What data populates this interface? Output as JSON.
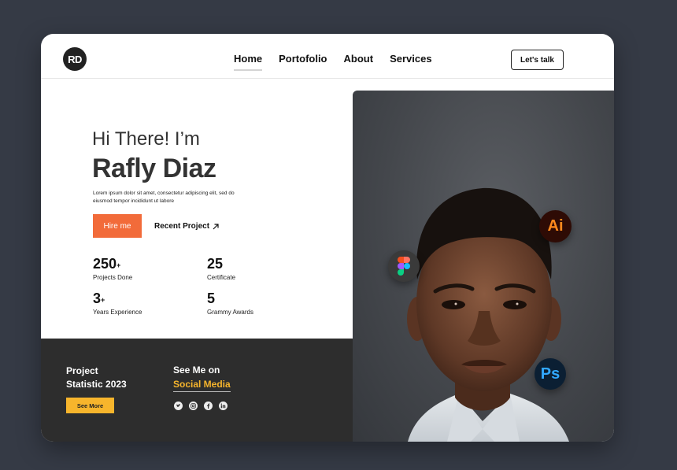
{
  "header": {
    "logo": "RD",
    "nav": [
      "Home",
      "Portofolio",
      "About",
      "Services"
    ],
    "cta": "Let's talk"
  },
  "hero": {
    "greeting": "Hi There! I’m",
    "name": "Rafly Diaz",
    "description": "Lorem ipsum dolor sit amet, consectetur adipiscing elit, sed do eiusmod tempor incididunt ut labore",
    "hire_label": "Hire me",
    "recent_label": "Recent Project"
  },
  "stats": [
    {
      "value": "250",
      "suffix": "+",
      "label": "Projects Done"
    },
    {
      "value": "25",
      "suffix": "",
      "label": "Certificate"
    },
    {
      "value": "3",
      "suffix": "+",
      "label": "Years Experience"
    },
    {
      "value": "5",
      "suffix": "",
      "label": "Grammy Awards"
    }
  ],
  "footer": {
    "project_line1": "Project",
    "project_line2": "Statistic 2023",
    "see_more": "See More",
    "see_me": "See Me on",
    "social_media": "Social Media",
    "social_icons": [
      "twitter-icon",
      "instagram-icon",
      "facebook-icon",
      "linkedin-icon"
    ]
  },
  "tools": {
    "illustrator": "Ai",
    "photoshop": "Ps",
    "figma": "figma-icon"
  },
  "colors": {
    "accent_orange": "#f26b3a",
    "accent_yellow": "#f7b52c",
    "dark_panel": "#2d2d2d",
    "page_bg": "#353a45"
  }
}
